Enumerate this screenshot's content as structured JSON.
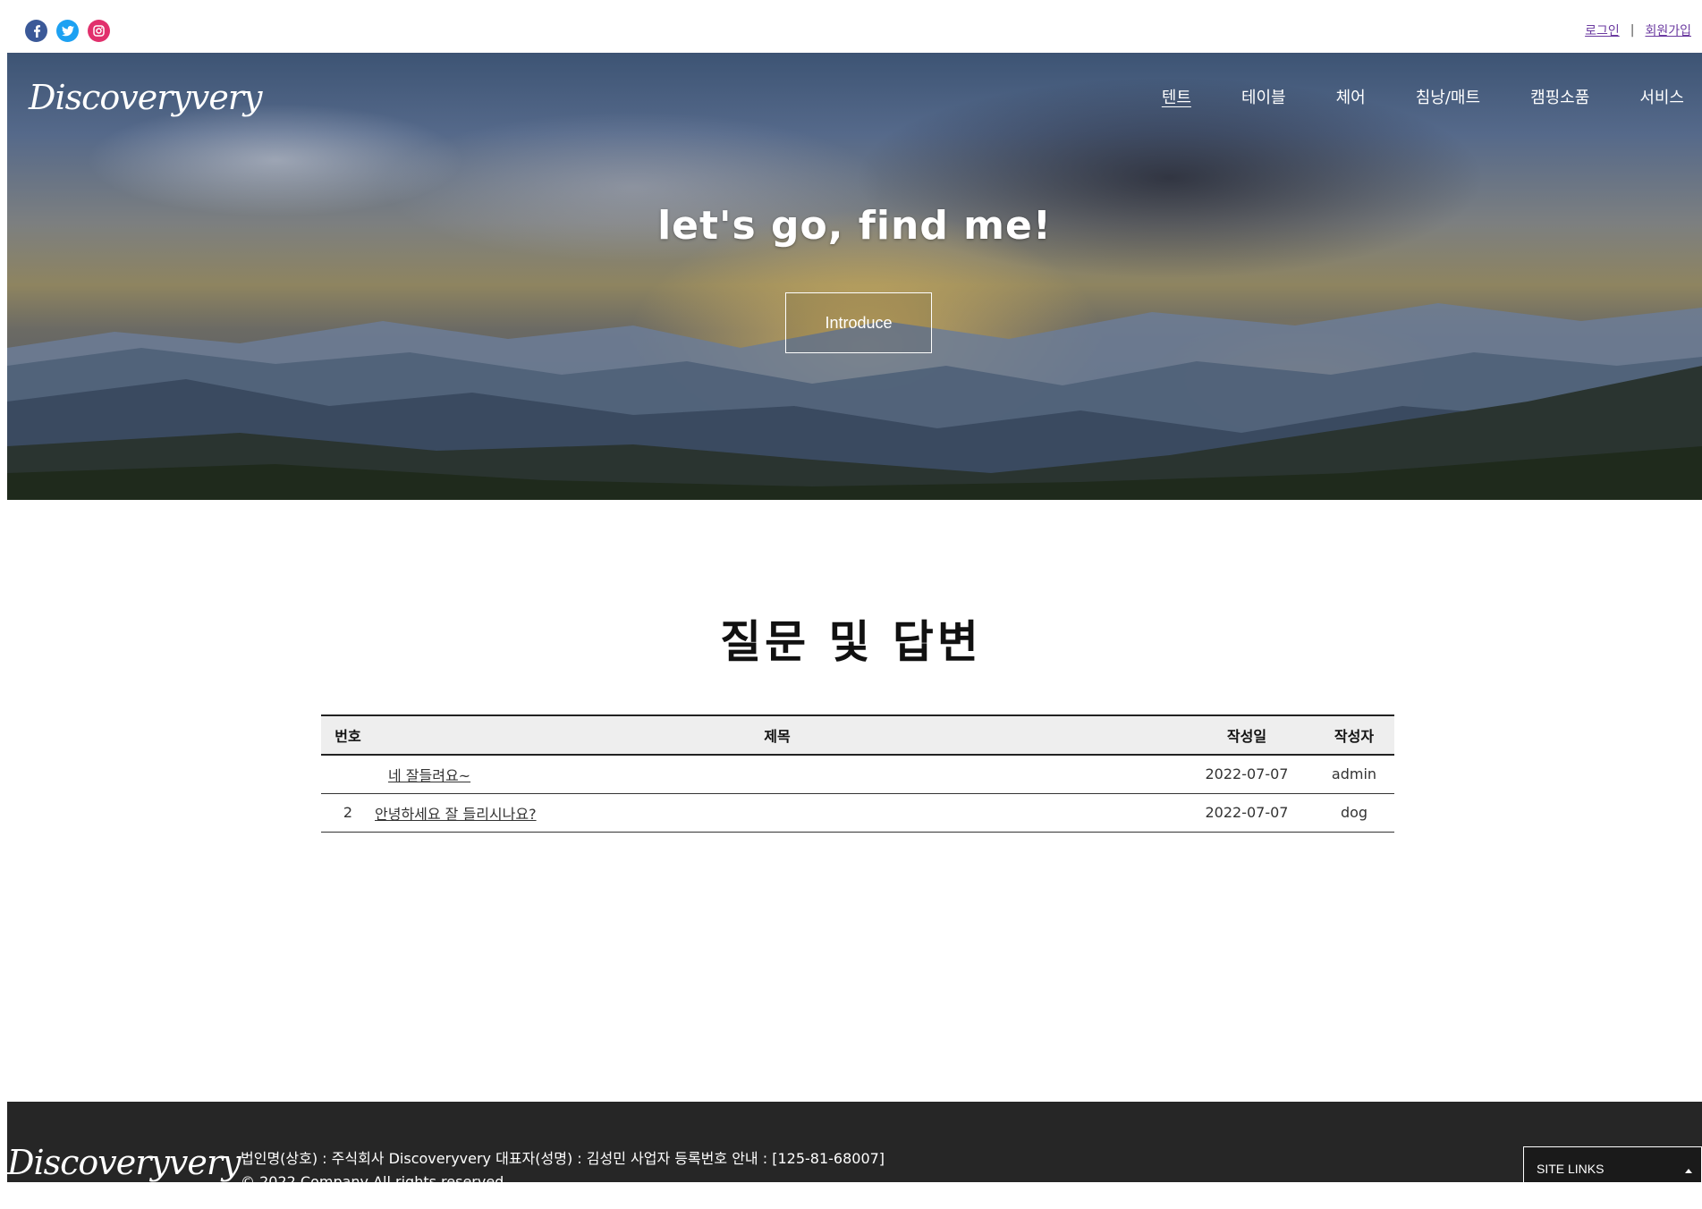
{
  "social": {
    "facebook": "facebook-icon",
    "twitter": "twitter-icon",
    "instagram": "instagram-icon"
  },
  "auth": {
    "login": "로그인",
    "separator": "|",
    "signup": "회원가입"
  },
  "hero": {
    "logo": "Discoveryvery",
    "nav": [
      "텐트",
      "테이블",
      "체어",
      "침낭/매트",
      "캠핑소품",
      "서비스"
    ],
    "tagline": "let's go, find me!",
    "button": "Introduce"
  },
  "board": {
    "title": "질문 및 답변",
    "headers": {
      "no": "번호",
      "title": "제목",
      "date": "작성일",
      "author": "작성자"
    },
    "rows": [
      {
        "no": "",
        "title": "네 잘들려요~",
        "date": "2022-07-07",
        "author": "admin"
      },
      {
        "no": "2",
        "title": "안녕하세요 잘 들리시나요?",
        "date": "2022-07-07",
        "author": "dog"
      }
    ]
  },
  "footer": {
    "logo": "Discoveryvery",
    "info": "법인명(상호) : 주식회사 Discoveryvery 대표자(성명) : 김성민 사업자 등록번호 안내 : [125-81-68007]",
    "copyright": "© 2022 Company All rights reserved",
    "site_links": "SITE LINKS"
  },
  "colors": {
    "facebook": "#3b5998",
    "twitter": "#1da1f2",
    "instagram": "#e1306c",
    "footer_bg": "#262626",
    "link_visited": "#6b3aa0"
  }
}
